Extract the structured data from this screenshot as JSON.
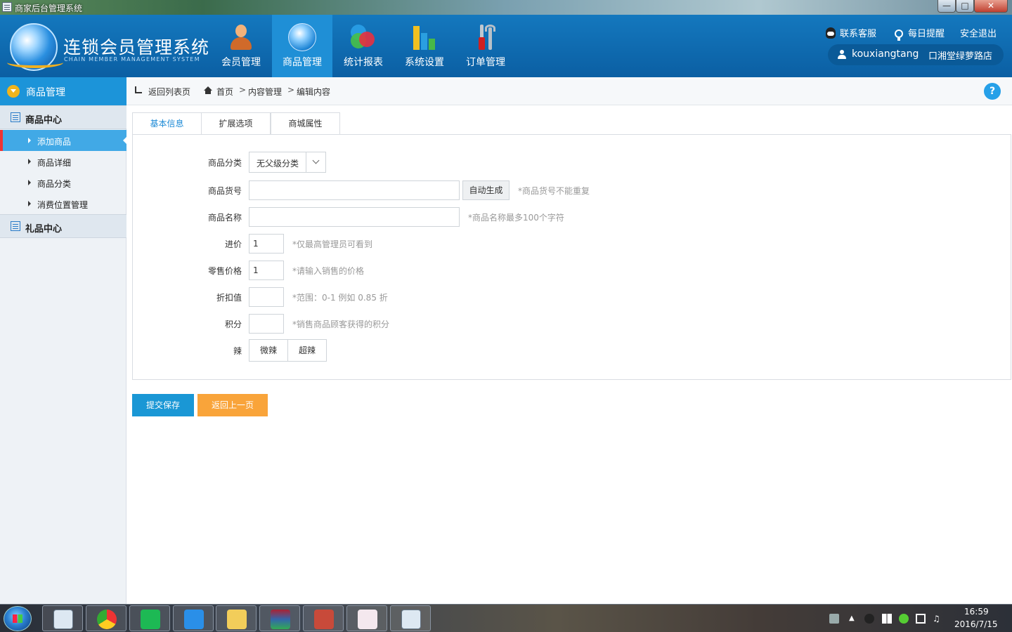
{
  "window": {
    "title": "商家后台管理系统"
  },
  "header": {
    "logo_title": "连锁会员管理系统",
    "logo_subtitle": "CHAIN MEMBER MANAGEMENT SYSTEM",
    "nav": [
      {
        "label": "会员管理",
        "icon": "member-icon",
        "active": false
      },
      {
        "label": "商品管理",
        "icon": "globe-icon",
        "active": true
      },
      {
        "label": "统计报表",
        "icon": "stats-icon",
        "active": false
      },
      {
        "label": "系统设置",
        "icon": "bar-chart-icon",
        "active": false
      },
      {
        "label": "订单管理",
        "icon": "tools-icon",
        "active": false
      }
    ],
    "links": {
      "support": "联系客服",
      "reminder": "每日提醒",
      "logout": "安全退出"
    },
    "user": {
      "name": "kouxiangtang",
      "store": "口湘堂绿萝路店"
    }
  },
  "sidebar": {
    "title": "商品管理",
    "groups": [
      {
        "label": "商品中心",
        "items": [
          "添加商品",
          "商品详细",
          "商品分类",
          "消费位置管理"
        ]
      },
      {
        "label": "礼品中心",
        "items": []
      }
    ],
    "active_item": "添加商品"
  },
  "breadcrumb": {
    "back": "返回列表页",
    "path": [
      "首页",
      "内容管理",
      "编辑内容"
    ],
    "separator": ">"
  },
  "tabs": [
    "基本信息",
    "扩展选项",
    "商城属性"
  ],
  "form": {
    "category": {
      "label": "商品分类",
      "value": "无父级分类"
    },
    "sku": {
      "label": "商品货号",
      "value": "",
      "button": "自动生成",
      "hint": "*商品货号不能重复"
    },
    "name": {
      "label": "商品名称",
      "value": "",
      "hint": "*商品名称最多100个字符"
    },
    "cost": {
      "label": "进价",
      "value": "1",
      "hint": "*仅最高管理员可看到"
    },
    "price": {
      "label": "零售价格",
      "value": "1",
      "hint": "*请输入销售的价格"
    },
    "discount": {
      "label": "折扣值",
      "value": "",
      "hint": "*范围：0-1 例如 0.85 折"
    },
    "points": {
      "label": "积分",
      "value": "",
      "hint": "*销售商品顾客获得的积分"
    },
    "spicy": {
      "label": "辣",
      "options": [
        "微辣",
        "超辣"
      ]
    }
  },
  "actions": {
    "save": "提交保存",
    "back": "返回上一页"
  },
  "taskbar": {
    "time": "16:59",
    "date": "2016/7/15"
  },
  "colors": {
    "header": "#1478be",
    "active_nav": "#1f8fd6",
    "primary": "#1a97d5",
    "warning": "#f9a43a",
    "sidebar_active": "#41a9e6"
  }
}
